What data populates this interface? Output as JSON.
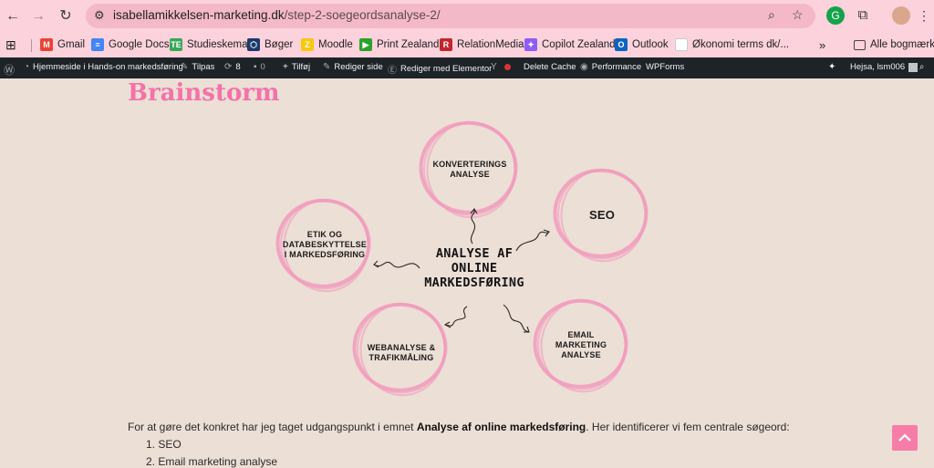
{
  "browser": {
    "url_host": "isabellamikkelsen-marketing.dk",
    "url_path": "/step-2-soegeordsanalyse-2/"
  },
  "bookmarks": [
    {
      "label": "Gmail",
      "icon": "gmail-icon",
      "color": "#ea4335",
      "glyph": "M"
    },
    {
      "label": "Google Docs",
      "icon": "docs-icon",
      "color": "#4285f4",
      "glyph": "≡"
    },
    {
      "label": "Studieskema",
      "icon": "calendar-icon",
      "color": "#3aa757",
      "glyph": "TE"
    },
    {
      "label": "Bøger",
      "icon": "book-icon",
      "color": "#1b3a6b",
      "glyph": "⬡"
    },
    {
      "label": "Moodle",
      "icon": "moodle-icon",
      "color": "#f9c80e",
      "glyph": "Z"
    },
    {
      "label": "Print Zealand",
      "icon": "print-icon",
      "color": "#29a329",
      "glyph": "▶"
    },
    {
      "label": "RelationMedia",
      "icon": "relationmedia-icon",
      "color": "#c0262e",
      "glyph": "R"
    },
    {
      "label": "Copilot Zealand",
      "icon": "copilot-icon",
      "color": "#8e5cf7",
      "glyph": "✦"
    },
    {
      "label": "Outlook",
      "icon": "outlook-icon",
      "color": "#0a64c2",
      "glyph": "O"
    },
    {
      "label": "Økonomi terms dk/...",
      "icon": "page-icon",
      "color": "#ffffff",
      "glyph": ""
    }
  ],
  "bookmarks_more": "»",
  "bookmarks_folder": "Alle bogmærker",
  "wpbar": {
    "site": "Hjemmeside i Hands-on markedsføring",
    "customize": "Tilpas",
    "updates": "8",
    "comments": "0",
    "new": "Tilføj",
    "edit_page": "Rediger side",
    "elementor": "Rediger med Elementor",
    "delete_cache": "Delete Cache",
    "performance": "Performance",
    "wpforms": "WPForms",
    "greeting": "Hejsa, lsm006"
  },
  "heading": "Brainstorm",
  "diagram": {
    "center": [
      "ANALYSE AF",
      "ONLINE",
      "MARKEDSFØRING"
    ],
    "bubbles": [
      {
        "lines": [
          "KONVERTERINGS",
          "ANALYSE"
        ]
      },
      {
        "lines": [
          "SEO"
        ]
      },
      {
        "lines": [
          "EMAIL",
          "MARKETING",
          "ANALYSE"
        ]
      },
      {
        "lines": [
          "WEBANALYSE &",
          "TRAFIKMÅLING"
        ]
      },
      {
        "lines": [
          "ETIK OG",
          "DATABESKYTTELSE",
          "I MARKEDSFØRING"
        ]
      }
    ],
    "accent_color": "#f29bbd"
  },
  "intro": {
    "before": "For at gøre det konkret har jeg taget udgangspunkt i emnet ",
    "bold": "Analyse af online markedsføring",
    "after": ". Her identificerer vi fem centrale søgeord:"
  },
  "keywords": [
    "1. SEO",
    "2. Email marketing analyse"
  ]
}
